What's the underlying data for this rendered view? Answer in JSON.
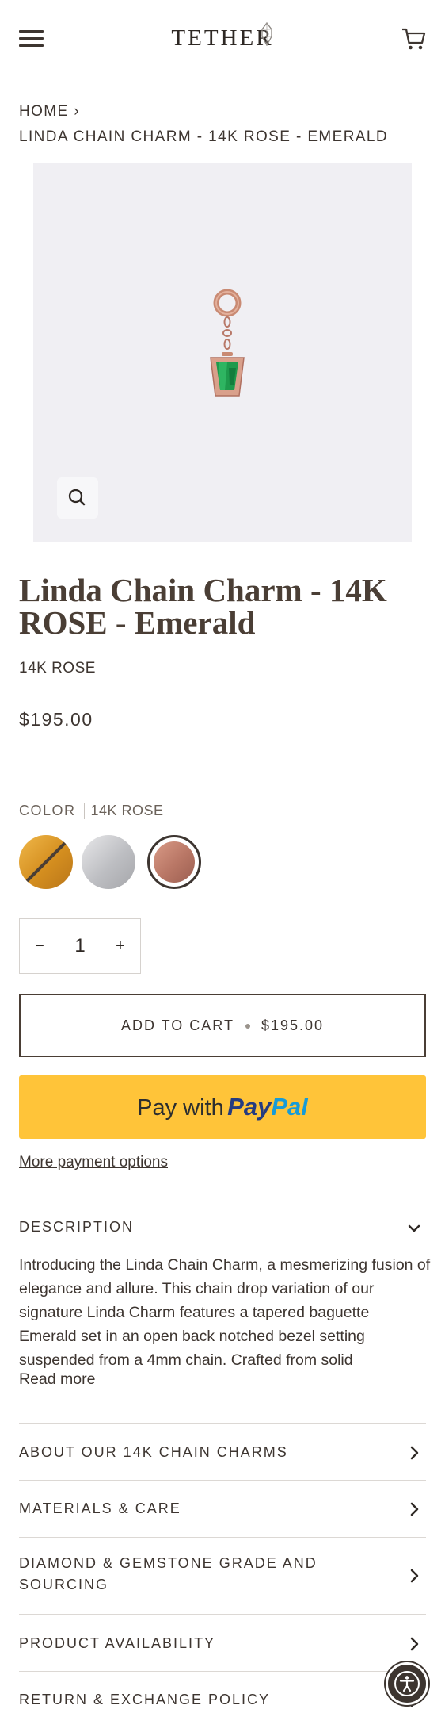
{
  "header": {
    "logo_text": "TETHER",
    "menu_icon": "hamburger-menu-icon",
    "cart_icon": "shopping-cart-icon"
  },
  "breadcrumb": {
    "home": "HOME",
    "separator": "›",
    "current": "LINDA CHAIN CHARM - 14K ROSE - EMERALD"
  },
  "gallery": {
    "zoom_icon": "magnifier-icon"
  },
  "product": {
    "title": "Linda Chain Charm - 14K ROSE - Emerald",
    "variant": "14K ROSE",
    "price": "$195.00"
  },
  "color": {
    "label": "COLOR",
    "selected": "14K ROSE",
    "swatches": [
      {
        "name": "14K YELLOW",
        "color": "#d89a2a",
        "available": false
      },
      {
        "name": "14K WHITE",
        "color": "#c4c5c9",
        "available": true
      },
      {
        "name": "14K ROSE",
        "color": "#b87665",
        "selected": true
      }
    ]
  },
  "quantity": {
    "minus": "−",
    "value": "1",
    "plus": "+"
  },
  "buttons": {
    "add_to_cart": "ADD TO CART",
    "add_to_cart_price": "$195.00",
    "paypal_prefix": "Pay with",
    "paypal_brand_1": "Pay",
    "paypal_brand_2": "Pal",
    "more_payment": "More payment options",
    "paypal_color": "#ffc439"
  },
  "description": {
    "title": "DESCRIPTION",
    "text": "Introducing the Linda Chain Charm, a mesmerizing fusion of elegance and allure. This chain drop variation of our signature Linda Charm features a tapered baguette Emerald set in an open back notched bezel setting suspended from a 4mm chain. Crafted from solid",
    "read_more": "Read more"
  },
  "accordions": [
    {
      "title": "ABOUT OUR 14K CHAIN CHARMS"
    },
    {
      "title": "MATERIALS & CARE"
    },
    {
      "title": "DIAMOND & GEMSTONE GRADE AND SOURCING"
    },
    {
      "title": "PRODUCT AVAILABILITY"
    },
    {
      "title": "RETURN & EXCHANGE POLICY"
    }
  ],
  "accessibility": {
    "icon": "accessibility-icon"
  },
  "colors": {
    "text": "#3d3530",
    "title": "#4a3e35",
    "image_bg": "#f0eff3",
    "emerald": "#1e9a4c",
    "rose_gold": "#c98a73"
  }
}
